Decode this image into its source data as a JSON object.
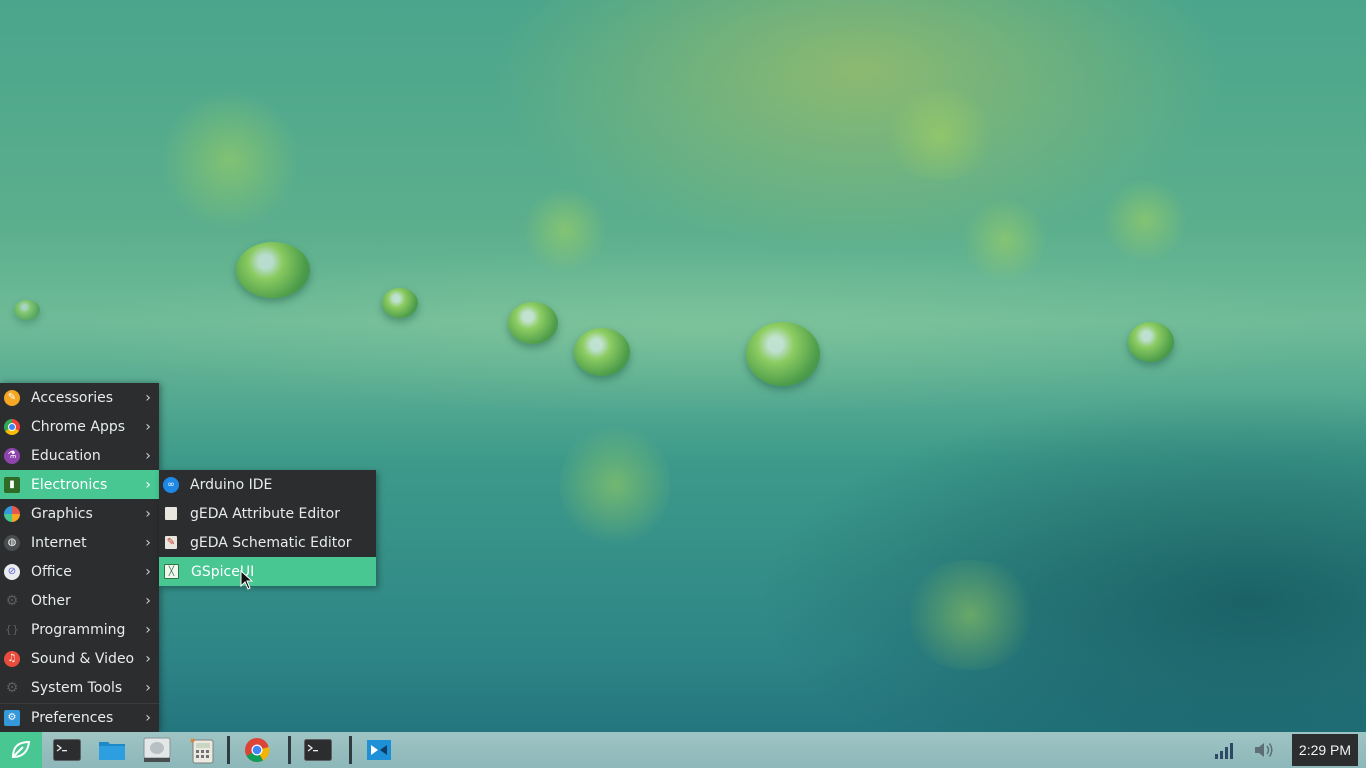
{
  "menu": {
    "items": [
      {
        "label": "Accessories",
        "icon": "accessories-icon",
        "color": "#f5a623"
      },
      {
        "label": "Chrome Apps",
        "icon": "chrome-apps-icon",
        "color": "#dd4b39"
      },
      {
        "label": "Education",
        "icon": "education-icon",
        "color": "#8e44ad"
      },
      {
        "label": "Electronics",
        "icon": "electronics-icon",
        "color": "#3b8a2a"
      },
      {
        "label": "Graphics",
        "icon": "graphics-icon",
        "color": "#e8554e"
      },
      {
        "label": "Internet",
        "icon": "internet-icon",
        "color": "#4a4d4f"
      },
      {
        "label": "Office",
        "icon": "office-icon",
        "color": "#5a5de0"
      },
      {
        "label": "Other",
        "icon": "other-icon",
        "color": "#4a4d4f"
      },
      {
        "label": "Programming",
        "icon": "programming-icon",
        "color": "#4a4d4f"
      },
      {
        "label": "Sound & Video",
        "icon": "sound-video-icon",
        "color": "#e74c3c"
      },
      {
        "label": "System Tools",
        "icon": "system-tools-icon",
        "color": "#4a4d4f"
      },
      {
        "label": "Preferences",
        "icon": "preferences-icon",
        "color": "#3498db"
      }
    ],
    "active_index": 3
  },
  "submenu": {
    "items": [
      {
        "label": "Arduino IDE",
        "icon": "arduino-icon"
      },
      {
        "label": "gEDA Attribute Editor",
        "icon": "geda-attribute-editor-icon"
      },
      {
        "label": "gEDA Schematic Editor",
        "icon": "geda-schematic-editor-icon"
      },
      {
        "label": "GSpiceUI",
        "icon": "gspiceui-icon"
      }
    ],
    "active_index": 3
  },
  "taskbar": {
    "apps": [
      {
        "name": "terminal-launcher",
        "icon": "terminal-icon"
      },
      {
        "name": "file-manager-launcher",
        "icon": "folder-icon"
      },
      {
        "name": "disk-utility-launcher",
        "icon": "disk-icon"
      },
      {
        "name": "calculator-launcher",
        "icon": "calculator-icon"
      },
      {
        "name": "chrome-window",
        "icon": "chrome-icon"
      },
      {
        "name": "terminal-window",
        "icon": "terminal-icon"
      },
      {
        "name": "remote-desktop-window",
        "icon": "remote-desktop-icon"
      }
    ],
    "clock": "2:29 PM"
  },
  "colors": {
    "menu_bg": "#2b2d2e",
    "accent": "#48c792",
    "taskbar": "#9fc4c4"
  }
}
